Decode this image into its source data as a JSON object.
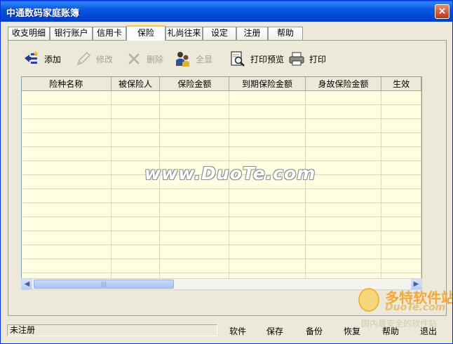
{
  "window": {
    "title": "中通数码家庭账簿",
    "close_glyph": "×"
  },
  "tabs": [
    {
      "label": "收支明细",
      "active": false
    },
    {
      "label": "银行账户",
      "active": false
    },
    {
      "label": "信用卡",
      "active": false
    },
    {
      "label": "保险",
      "active": true
    },
    {
      "label": "礼尚往来",
      "active": false
    },
    {
      "label": "设定",
      "active": false
    },
    {
      "label": "注册",
      "active": false
    },
    {
      "label": "帮助",
      "active": false
    }
  ],
  "toolbar": {
    "add": {
      "label": "添加",
      "icon": "add-record-icon",
      "enabled": true
    },
    "edit": {
      "label": "修改",
      "icon": "pencil-icon",
      "enabled": false
    },
    "delete": {
      "label": "删除",
      "icon": "x-delete-icon",
      "enabled": false
    },
    "show_all": {
      "label": "全显",
      "icon": "people-icon",
      "enabled": false
    },
    "print_preview": {
      "label": "打印预览",
      "icon": "print-preview-icon",
      "enabled": true
    },
    "print": {
      "label": "打印",
      "icon": "printer-icon",
      "enabled": true
    }
  },
  "grid": {
    "columns": [
      "险种名称",
      "被保险人",
      "保险金额",
      "到期保险金额",
      "身故保险金额",
      "生效"
    ],
    "row_count": 14,
    "background": "#FFFFE1"
  },
  "watermark": "www.DuoTe.com",
  "logo": {
    "brand": "多特软件站",
    "sub": "DuoTe.com",
    "slogan": "国内最安全的软件站"
  },
  "statusbar": {
    "registration": "未注册",
    "buttons": {
      "software": "软件",
      "save": "保存",
      "backup": "备份",
      "restore": "恢复",
      "help": "帮助",
      "exit": "退出"
    }
  }
}
